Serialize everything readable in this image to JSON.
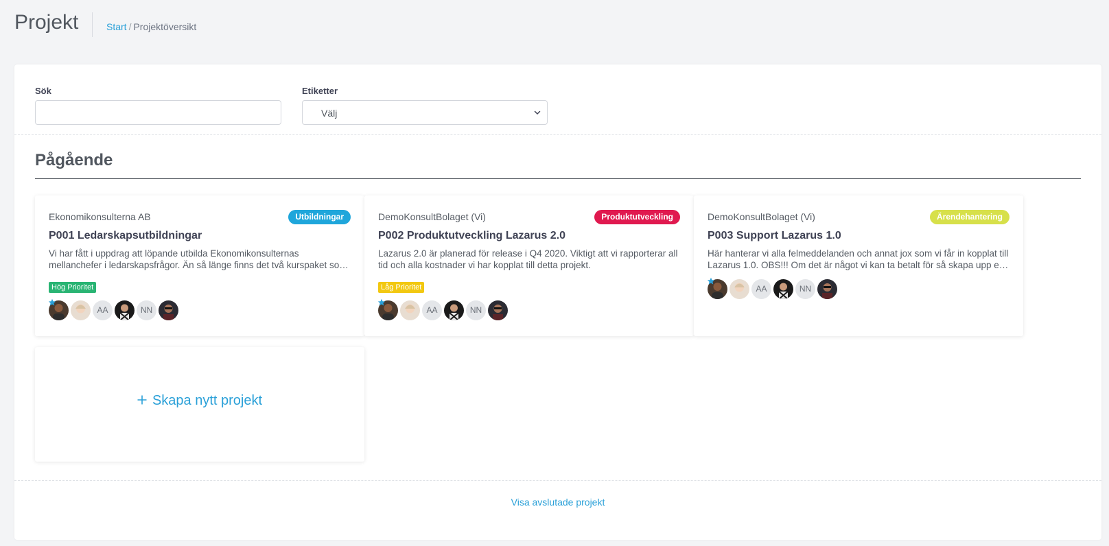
{
  "header": {
    "title": "Projekt",
    "breadcrumb": {
      "home": "Start",
      "separator": "/",
      "current": "Projektöversikt"
    }
  },
  "filters": {
    "search_label": "Sök",
    "search_value": "",
    "tags_label": "Etiketter",
    "tags_selected": "Välj"
  },
  "section": {
    "title": "Pågående"
  },
  "projects": [
    {
      "client": "Ekonomikonsulterna AB",
      "badge": "Utbildningar",
      "badge_color": "#1fa6db",
      "title": "P001 Ledarskapsutbildningar",
      "description": "Vi har fått i uppdrag att löpande utbilda Ekonomikonsulternas mellanchefer i ledarskapsfrågor. Än så länge finns det två kurspaket som ska genomföras under året.",
      "priority": "Hög Prioritet",
      "priority_color": "#29b473",
      "members": [
        "AA",
        "NN"
      ]
    },
    {
      "client": "DemoKonsultBolaget (Vi)",
      "badge": "Produktutveckling",
      "badge_color": "#e0194f",
      "title": "P002 Produktutveckling Lazarus 2.0",
      "description": "Lazarus 2.0 är planerad för release i Q4 2020. Viktigt att vi rapporterar all tid och alla kostnader vi har kopplat till detta projekt.",
      "priority": "Låg Prioritet",
      "priority_color": "#f2c811",
      "members": [
        "AA",
        "NN"
      ]
    },
    {
      "client": "DemoKonsultBolaget (Vi)",
      "badge": "Ärendehantering",
      "badge_color": "#d7e04a",
      "title": "P003 Support Lazarus 1.0",
      "description": "Här hanterar vi alla felmeddelanden och annat jox som vi får in kopplat till Lazarus 1.0. OBS!!! Om det är något vi kan ta betalt för så skapa upp en separat ordning.",
      "priority": "",
      "priority_color": "",
      "members": [
        "AA",
        "NN"
      ]
    }
  ],
  "create_project": {
    "label": "Skapa nytt projekt",
    "icon": "plus-icon"
  },
  "footer": {
    "show_closed": "Visa avslutade projekt"
  },
  "colors": {
    "accent": "#2aa0d8",
    "background": "#f3f4f6",
    "text": "#3f4254"
  }
}
